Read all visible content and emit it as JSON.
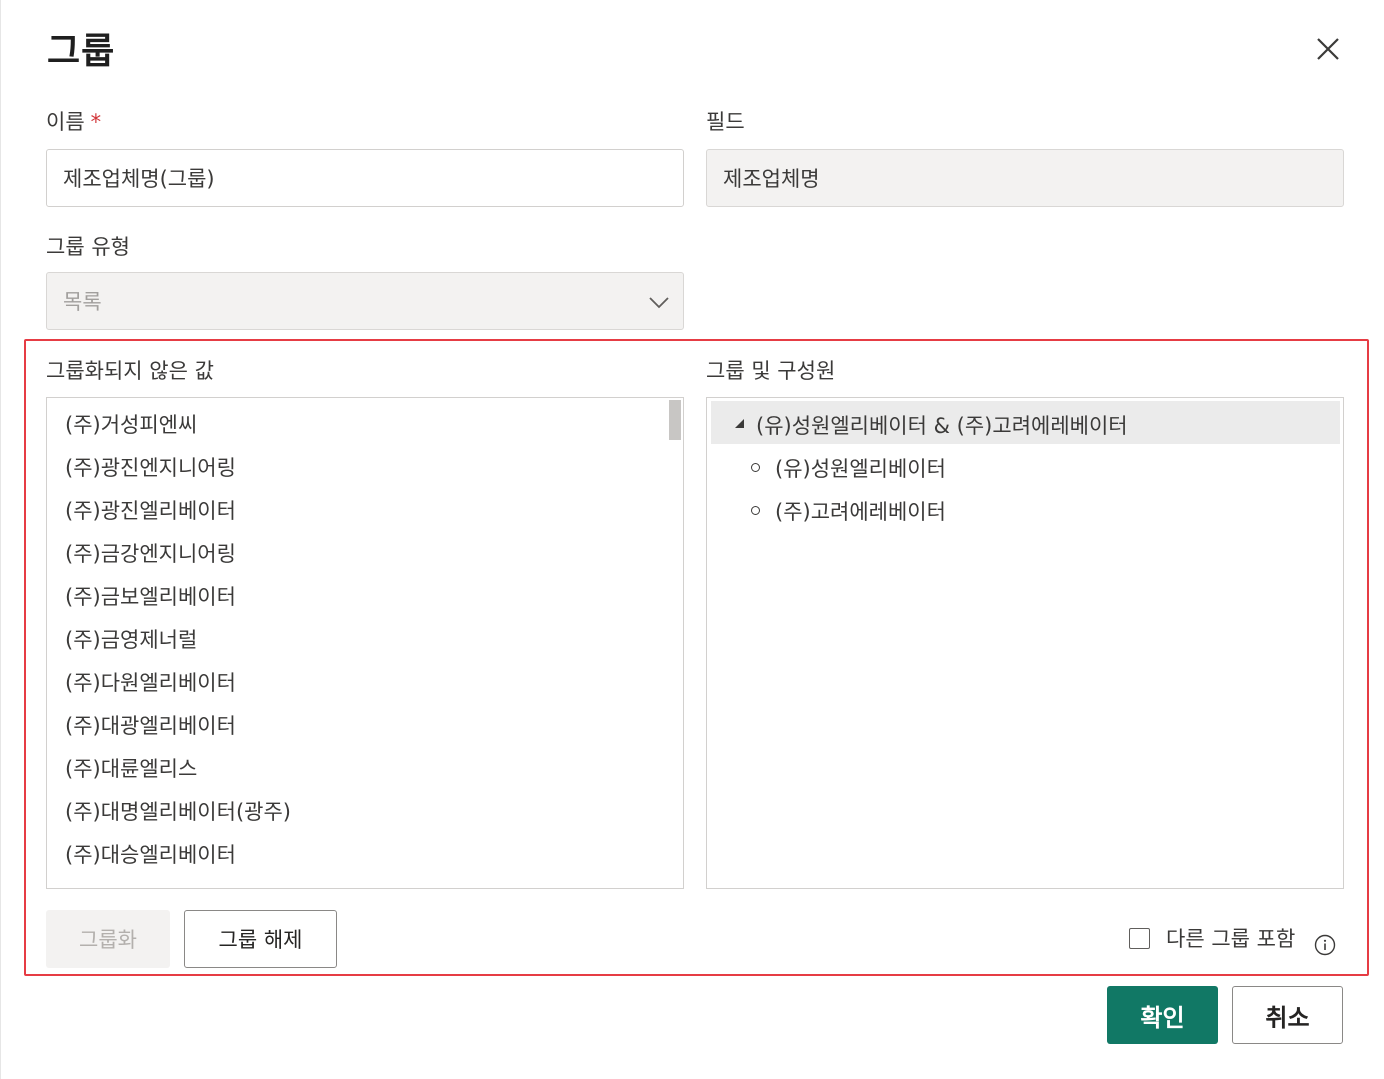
{
  "dialog": {
    "title": "그룹",
    "close_icon": "close-icon"
  },
  "name_field": {
    "label": "이름",
    "required_mark": "*",
    "value": "제조업체명(그룹)"
  },
  "field_field": {
    "label": "필드",
    "value": "제조업체명"
  },
  "group_type": {
    "label": "그룹 유형",
    "value": "목록",
    "icon": "chevron-down-icon"
  },
  "ungrouped": {
    "label": "그룹화되지 않은 값",
    "items": [
      "(주)거성피엔씨",
      "(주)광진엔지니어링",
      "(주)광진엘리베이터",
      "(주)금강엔지니어링",
      "(주)금보엘리베이터",
      "(주)금영제너럴",
      "(주)다원엘리베이터",
      "(주)대광엘리베이터",
      "(주)대륜엘리스",
      "(주)대명엘리베이터(광주)",
      "(주)대승엘리베이터"
    ]
  },
  "groups": {
    "label": "그룹 및 구성원",
    "group_name": "(유)성원엘리베이터 & (주)고려에레베이터",
    "members": [
      "(유)성원엘리베이터",
      "(주)고려에레베이터"
    ]
  },
  "actions": {
    "group_label": "그룹화",
    "ungroup_label": "그룹 해제",
    "include_other_label": "다른 그룹 포함",
    "info_icon": "info-icon"
  },
  "footer": {
    "ok_label": "확인",
    "cancel_label": "취소"
  },
  "colors": {
    "primary": "#117865",
    "highlight": "#e63c44",
    "required": "#d13438"
  }
}
